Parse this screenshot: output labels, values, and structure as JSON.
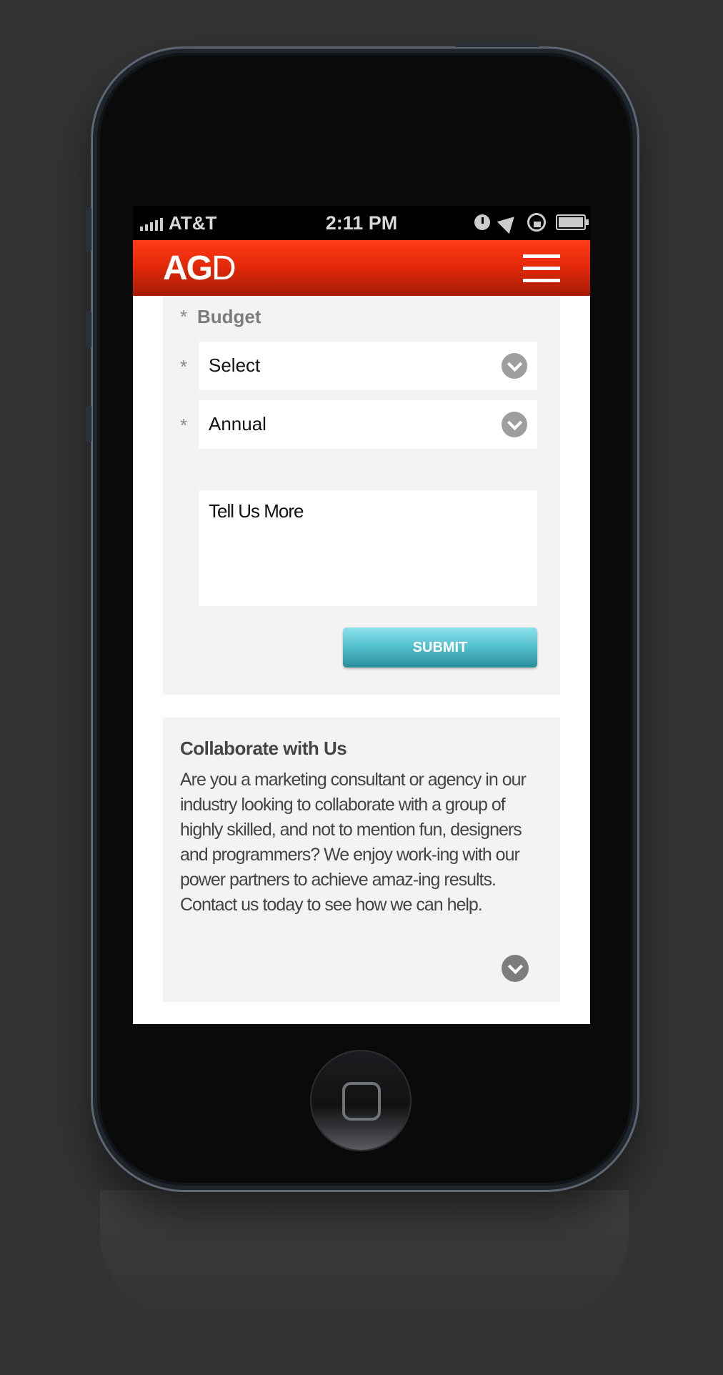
{
  "statusbar": {
    "carrier": "AT&T",
    "time": "2:11 PM"
  },
  "header": {
    "logo_bold": "AG",
    "logo_light": "D"
  },
  "form": {
    "required_marker": "*",
    "budget_label": "Budget",
    "budget_select_value": "Select",
    "frequency_select_value": "Annual",
    "message_placeholder": "Tell Us More",
    "submit_label": "SUBMIT"
  },
  "collaborate": {
    "title": "Collaborate with Us",
    "body": "Are you a marketing consultant or agency in our industry looking to collaborate with a group of highly skilled, and not to mention fun, designers and programmers? We enjoy work-ing with our power partners to achieve amaz-ing results. Contact us today to see how we can help."
  },
  "colors": {
    "header_red": "#e62a0a",
    "submit_teal": "#56c3d0",
    "panel_gray": "#f3f3f3"
  }
}
